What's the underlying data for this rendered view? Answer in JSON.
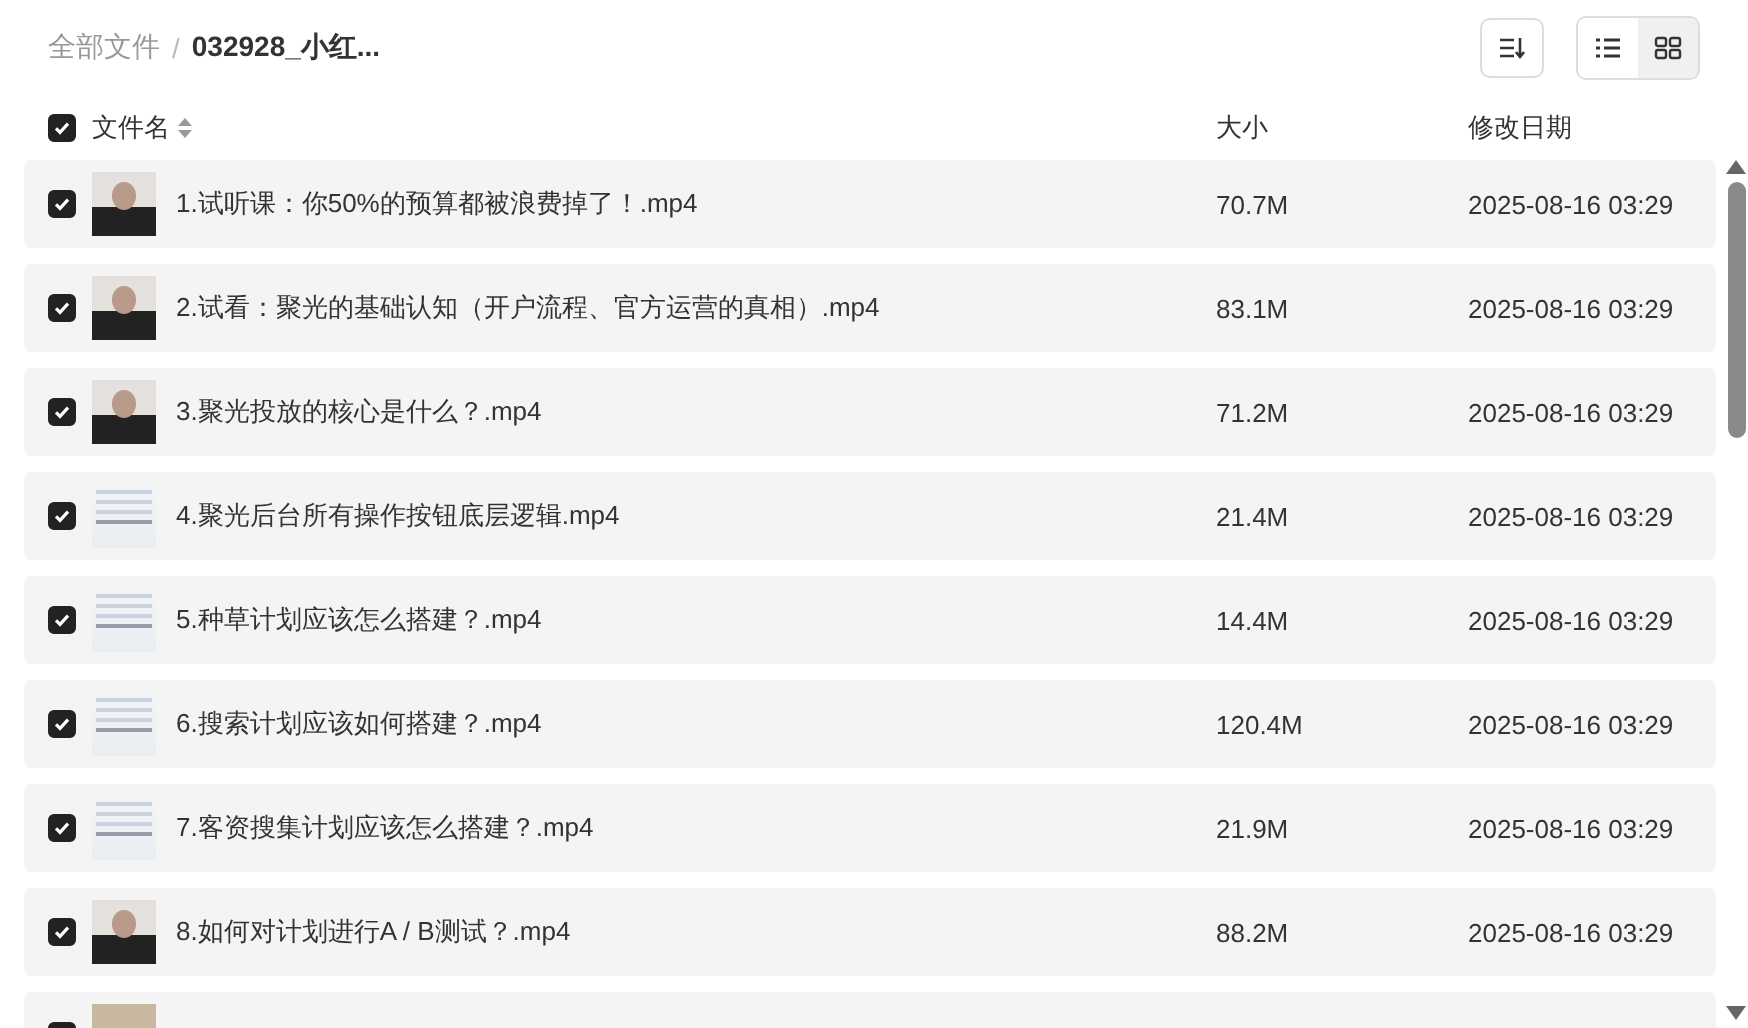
{
  "breadcrumb": [
    {
      "label": "全部文件",
      "current": false
    },
    {
      "separator": "/",
      "label": "032928_小红...",
      "current": true
    }
  ],
  "toolbar": {
    "sort_selected": false,
    "view_modes": [
      {
        "kind": "list",
        "selected": false
      },
      {
        "kind": "grid",
        "selected": true
      }
    ]
  },
  "header": {
    "checked": true,
    "columns": [
      "文件名",
      "大小",
      "修改日期"
    ]
  },
  "rows": [
    {
      "checked": true,
      "kind": "person",
      "name": "1.试听课：你50%的预算都被浪费掉了！.mp4",
      "size": "70.7M",
      "modified": "2025-08-16 03:29"
    },
    {
      "checked": true,
      "kind": "person",
      "name": "2.试看：聚光的基础认知（开户流程、官方运营的真相）.mp4",
      "size": "83.1M",
      "modified": "2025-08-16 03:29"
    },
    {
      "checked": true,
      "kind": "person",
      "name": "3.聚光投放的核心是什么？.mp4",
      "size": "71.2M",
      "modified": "2025-08-16 03:29"
    },
    {
      "checked": true,
      "kind": "screen",
      "name": "4.聚光后台所有操作按钮底层逻辑.mp4",
      "size": "21.4M",
      "modified": "2025-08-16 03:29"
    },
    {
      "checked": true,
      "kind": "screen",
      "name": "5.种草计划应该怎么搭建？.mp4",
      "size": "14.4M",
      "modified": "2025-08-16 03:29"
    },
    {
      "checked": true,
      "kind": "screen",
      "name": "6.搜索计划应该如何搭建？.mp4",
      "size": "120.4M",
      "modified": "2025-08-16 03:29"
    },
    {
      "checked": true,
      "kind": "screen",
      "name": "7.客资搜集计划应该怎么搭建？.mp4",
      "size": "21.9M",
      "modified": "2025-08-16 03:29"
    },
    {
      "checked": true,
      "kind": "person",
      "name": "8.如何对计划进行A / B测试？.mp4",
      "size": "88.2M",
      "modified": "2025-08-16 03:29"
    }
  ],
  "partial_row": {
    "checked": true,
    "kind": "paper"
  }
}
